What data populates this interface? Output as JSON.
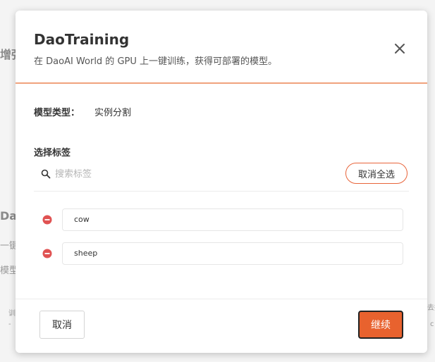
{
  "background": {
    "fragments": [
      "增强",
      "Dao",
      "一键",
      "模型类",
      "训",
      "-",
      "去报",
      "c"
    ]
  },
  "dialog": {
    "title": "DaoTraining",
    "subtitle": "在 DaoAI World 的 GPU 上一键训练，获得可部署的模型。",
    "close_icon": "close-icon",
    "accent_color": "#e8622e"
  },
  "model_type": {
    "label": "模型类型：",
    "value": "实例分割"
  },
  "labels_section": {
    "heading": "选择标签",
    "search_placeholder": "搜索标签",
    "search_value": "",
    "deselect_all_label": "取消全选",
    "tags": [
      "cow",
      "sheep"
    ]
  },
  "footer": {
    "cancel_label": "取消",
    "continue_label": "继续"
  }
}
